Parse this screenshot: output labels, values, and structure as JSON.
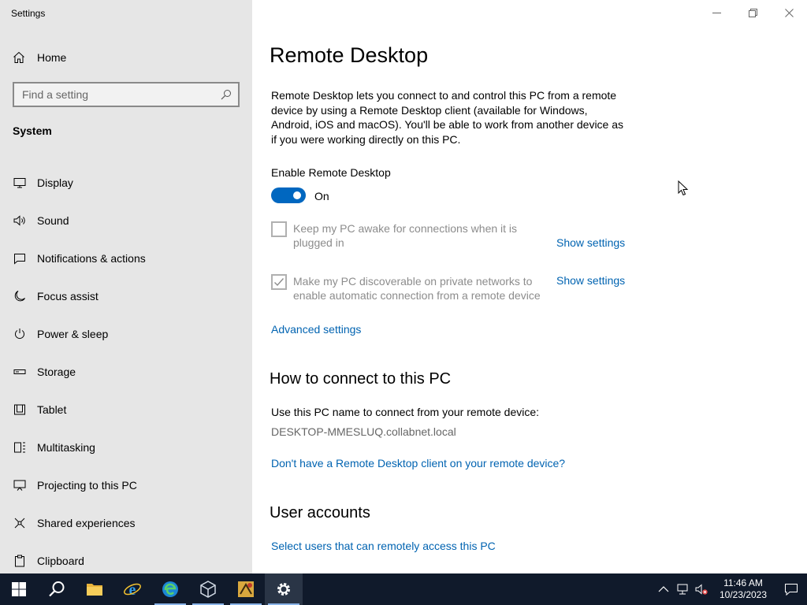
{
  "window": {
    "title": "Settings"
  },
  "sidebar": {
    "home_label": "Home",
    "search_placeholder": "Find a setting",
    "section": "System",
    "items": [
      {
        "label": "Display",
        "icon": "monitor-icon"
      },
      {
        "label": "Sound",
        "icon": "speaker-icon"
      },
      {
        "label": "Notifications & actions",
        "icon": "message-icon"
      },
      {
        "label": "Focus assist",
        "icon": "moon-icon"
      },
      {
        "label": "Power & sleep",
        "icon": "power-icon"
      },
      {
        "label": "Storage",
        "icon": "storage-icon"
      },
      {
        "label": "Tablet",
        "icon": "tablet-icon"
      },
      {
        "label": "Multitasking",
        "icon": "multitasking-icon"
      },
      {
        "label": "Projecting to this PC",
        "icon": "projecting-icon"
      },
      {
        "label": "Shared experiences",
        "icon": "shared-icon"
      },
      {
        "label": "Clipboard",
        "icon": "clipboard-icon"
      }
    ]
  },
  "main": {
    "title": "Remote Desktop",
    "description": "Remote Desktop lets you connect to and control this PC from a remote device by using a Remote Desktop client (available for Windows, Android, iOS and macOS). You'll be able to work from another device as if you were working directly on this PC.",
    "enable_label": "Enable Remote Desktop",
    "toggle_state": "On",
    "option1": {
      "text": "Keep my PC awake for connections when it is plugged in",
      "checked": false,
      "link": "Show settings"
    },
    "option2": {
      "text": "Make my PC discoverable on private networks to enable automatic connection from a remote device",
      "checked": true,
      "link": "Show settings"
    },
    "advanced_link": "Advanced settings",
    "how_to_heading": "How to connect to this PC",
    "how_to_text": "Use this PC name to connect from your remote device:",
    "pc_name": "DESKTOP-MMESLUQ.collabnet.local",
    "client_link": "Don't have a Remote Desktop client on your remote device?",
    "user_accounts_heading": "User accounts",
    "users_link": "Select users that can remotely access this PC"
  },
  "taskbar": {
    "time": "11:46 AM",
    "date": "10/23/2023"
  },
  "colors": {
    "accent": "#0067c0",
    "link": "#0063b1",
    "sidebar_bg": "#e6e6e6",
    "taskbar_bg": "#101a2b"
  }
}
